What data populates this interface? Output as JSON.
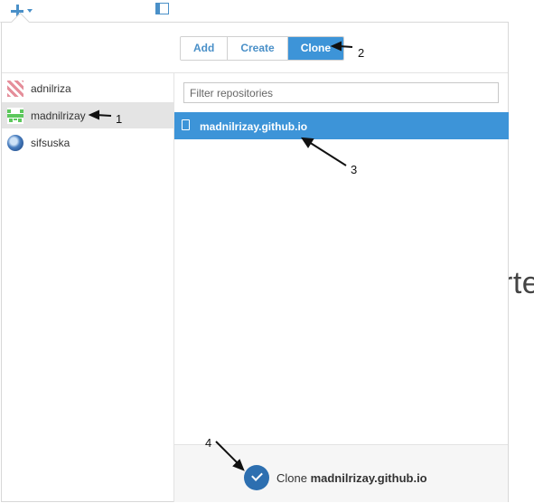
{
  "toolbar": {
    "add_icon": "plus-icon",
    "sidebar_icon": "sidebar-toggle-icon",
    "accent": "#4a90c8"
  },
  "background_text": "rte",
  "tabs": [
    {
      "label": "Add",
      "active": false
    },
    {
      "label": "Create",
      "active": false
    },
    {
      "label": "Clone",
      "active": true
    }
  ],
  "accounts": [
    {
      "name": "adnilriza",
      "selected": false
    },
    {
      "name": "madnilrizay",
      "selected": true
    },
    {
      "name": "sifsuska",
      "selected": false
    }
  ],
  "filter": {
    "placeholder": "Filter repositories",
    "value": ""
  },
  "repositories": [
    {
      "name": "madnilrizay.github.io",
      "selected": true
    }
  ],
  "footer": {
    "prefix": "Clone ",
    "repo": "madnilrizay.github.io"
  },
  "annotations": [
    "1",
    "2",
    "3",
    "4"
  ],
  "colors": {
    "selected_blue": "#3d94d8",
    "clone_check": "#2d6fb0"
  }
}
